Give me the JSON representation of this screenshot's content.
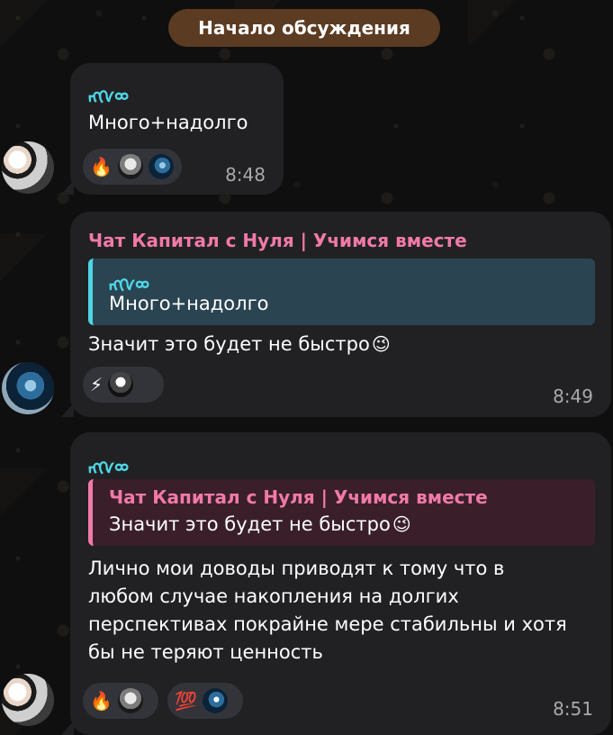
{
  "header": {
    "date_pill": "Начало обсуждения"
  },
  "messages": [
    {
      "sender": "ᡊᢉᢁ",
      "text": "Много+надолго",
      "time": "8:48",
      "reactions": [
        {
          "emoji": "🔥",
          "avatars": [
            "avatar-icon-1",
            "avatar-icon-2"
          ]
        }
      ]
    },
    {
      "sender": "Чат Капитал с Нуля | Учимся вместе",
      "quote": {
        "name": "ᡊᢉᢁ",
        "text": "Много+надолго"
      },
      "text": "Значит это будет не быстро",
      "time": "8:49",
      "reactions": [
        {
          "emoji": "⚡",
          "avatars": [
            "avatar-icon-3"
          ]
        }
      ]
    },
    {
      "sender": "ᡊᢉᢁ",
      "quote": {
        "name": "Чат Капитал с Нуля | Учимся вместе",
        "text": "Значит это будет не быстро"
      },
      "text": "Лично мои доводы приводят к тому что в любом случае накопления на долгих перспективах покрайне мере стабильны и хотя бы не теряют ценность",
      "time": "8:51",
      "reactions": [
        {
          "emoji": "🔥",
          "avatars": [
            "avatar-icon-4"
          ]
        },
        {
          "emoji": "💯",
          "avatars": [
            "avatar-icon-5"
          ]
        }
      ]
    }
  ],
  "icons": {
    "wink_emoji": "😉"
  },
  "colors": {
    "bubble_bg": "#212124",
    "name_blue": "#4fd6e5",
    "name_pink": "#f27aa7",
    "date_pill_bg": "#5b3b22"
  }
}
